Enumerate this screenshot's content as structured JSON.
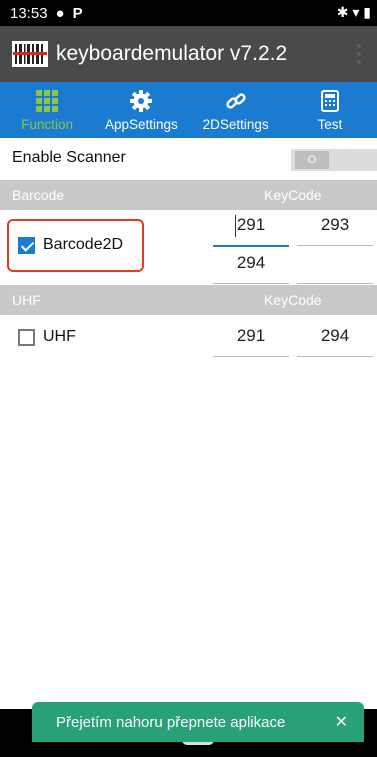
{
  "status_bar": {
    "time": "13:53",
    "app_icons": [
      "●",
      "P"
    ],
    "right_icons": "✱ ▾ ▮"
  },
  "app_bar": {
    "title": "keyboardemulator v7.2.2"
  },
  "tabs": [
    {
      "label": "Function",
      "icon": "grid-icon",
      "active": true
    },
    {
      "label": "AppSettings",
      "icon": "gear-icon",
      "active": false
    },
    {
      "label": "2DSettings",
      "icon": "link-icon",
      "active": false
    },
    {
      "label": "Test",
      "icon": "calculator-icon",
      "active": false
    }
  ],
  "enable_scanner": {
    "label": "Enable Scanner",
    "switch_text": "O",
    "on": false
  },
  "barcode_section": {
    "title": "Barcode",
    "keycode_header": "KeyCode"
  },
  "barcode2d": {
    "label": "Barcode2D",
    "checked": true,
    "keycodes": [
      "291",
      "293",
      "294",
      ""
    ]
  },
  "uhf_section": {
    "title": "UHF",
    "keycode_header": "KeyCode"
  },
  "uhf": {
    "label": "UHF",
    "checked": false,
    "keycodes": [
      "291",
      "294"
    ]
  },
  "toast": {
    "message": "Přejetím nahoru přepnete aplikace",
    "close": "✕"
  },
  "nav": {
    "back": "‹"
  },
  "colors": {
    "accent": "#1a7bd0",
    "active_tab": "#8bc34a",
    "appbar": "#4a4a4a",
    "toast": "#28a07a",
    "highlight": "#e53a1e",
    "section": "#c9c9c9"
  }
}
